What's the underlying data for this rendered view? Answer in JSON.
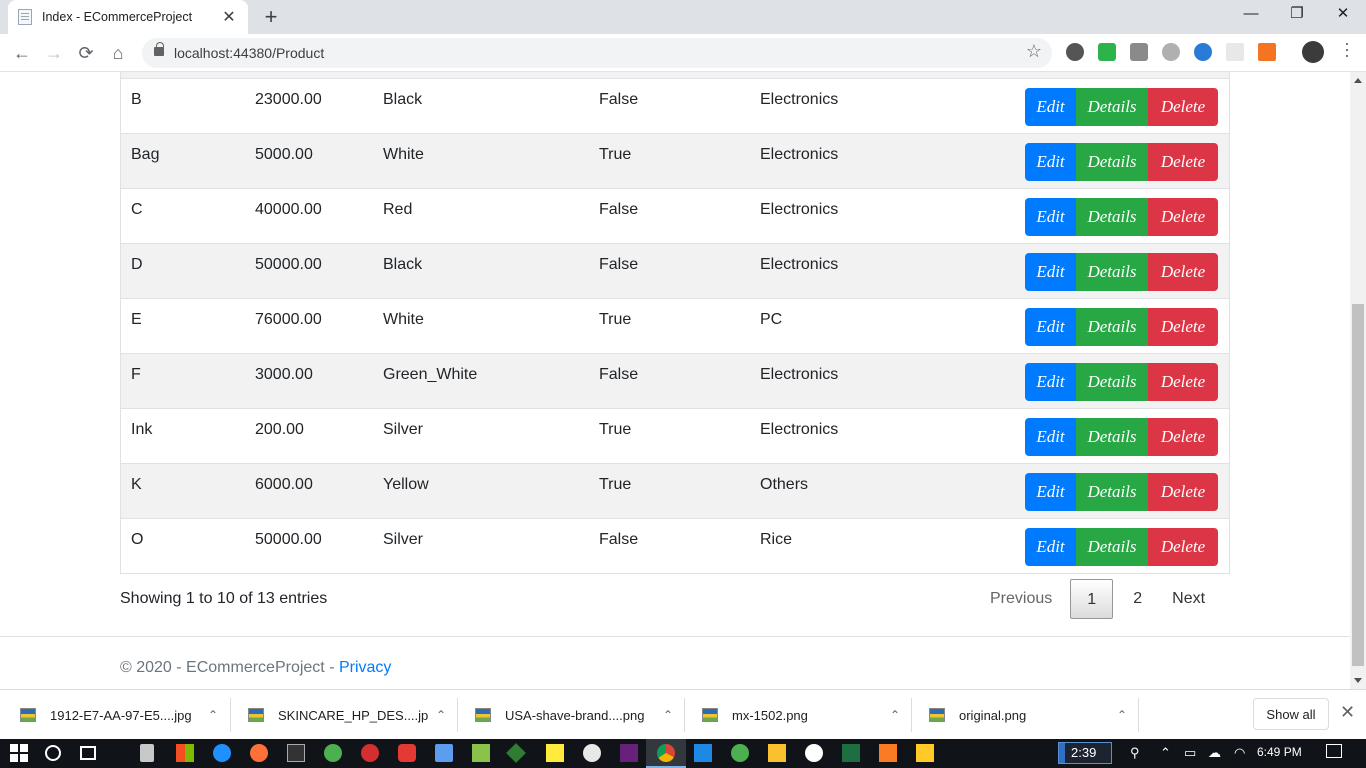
{
  "browser": {
    "tab_title": "Index - ECommerceProject",
    "tab_close": "✕",
    "new_tab": "+",
    "url": "localhost:44380/Product",
    "window": {
      "minimize": "—",
      "restore": "❐",
      "close": "✕"
    }
  },
  "table": {
    "rows": [
      {
        "name": "B",
        "price": "23000.00",
        "color": "Black",
        "available": "False",
        "category": "Electronics"
      },
      {
        "name": "Bag",
        "price": "5000.00",
        "color": "White",
        "available": "True",
        "category": "Electronics"
      },
      {
        "name": "C",
        "price": "40000.00",
        "color": "Red",
        "available": "False",
        "category": "Electronics"
      },
      {
        "name": "D",
        "price": "50000.00",
        "color": "Black",
        "available": "False",
        "category": "Electronics"
      },
      {
        "name": "E",
        "price": "76000.00",
        "color": "White",
        "available": "True",
        "category": "PC"
      },
      {
        "name": "F",
        "price": "3000.00",
        "color": "Green_White",
        "available": "False",
        "category": "Electronics"
      },
      {
        "name": "Ink",
        "price": "200.00",
        "color": "Silver",
        "available": "True",
        "category": "Electronics"
      },
      {
        "name": "K",
        "price": "6000.00",
        "color": "Yellow",
        "available": "True",
        "category": "Others"
      },
      {
        "name": "O",
        "price": "50000.00",
        "color": "Silver",
        "available": "False",
        "category": "Rice"
      }
    ],
    "actions": {
      "edit": "Edit",
      "details": "Details",
      "delete": "Delete"
    }
  },
  "pagination": {
    "info": "Showing 1 to 10 of 13 entries",
    "previous": "Previous",
    "pages": [
      "1",
      "2"
    ],
    "next": "Next"
  },
  "footer": {
    "copyright": "© 2020 - ECommerceProject - ",
    "privacy": "Privacy"
  },
  "downloads": {
    "items": [
      "1912-E7-AA-97-E5....jpg",
      "SKINCARE_HP_DES....jpg",
      "USA-shave-brand....png",
      "mx-1502.png",
      "original.png"
    ],
    "show_all": "Show all",
    "close": "✕"
  },
  "taskbar": {
    "box_text": "2:39",
    "time": "6:49 PM"
  },
  "colors": {
    "edit": "#007bff",
    "details": "#28a745",
    "delete": "#dc3545",
    "link": "#007bff"
  }
}
